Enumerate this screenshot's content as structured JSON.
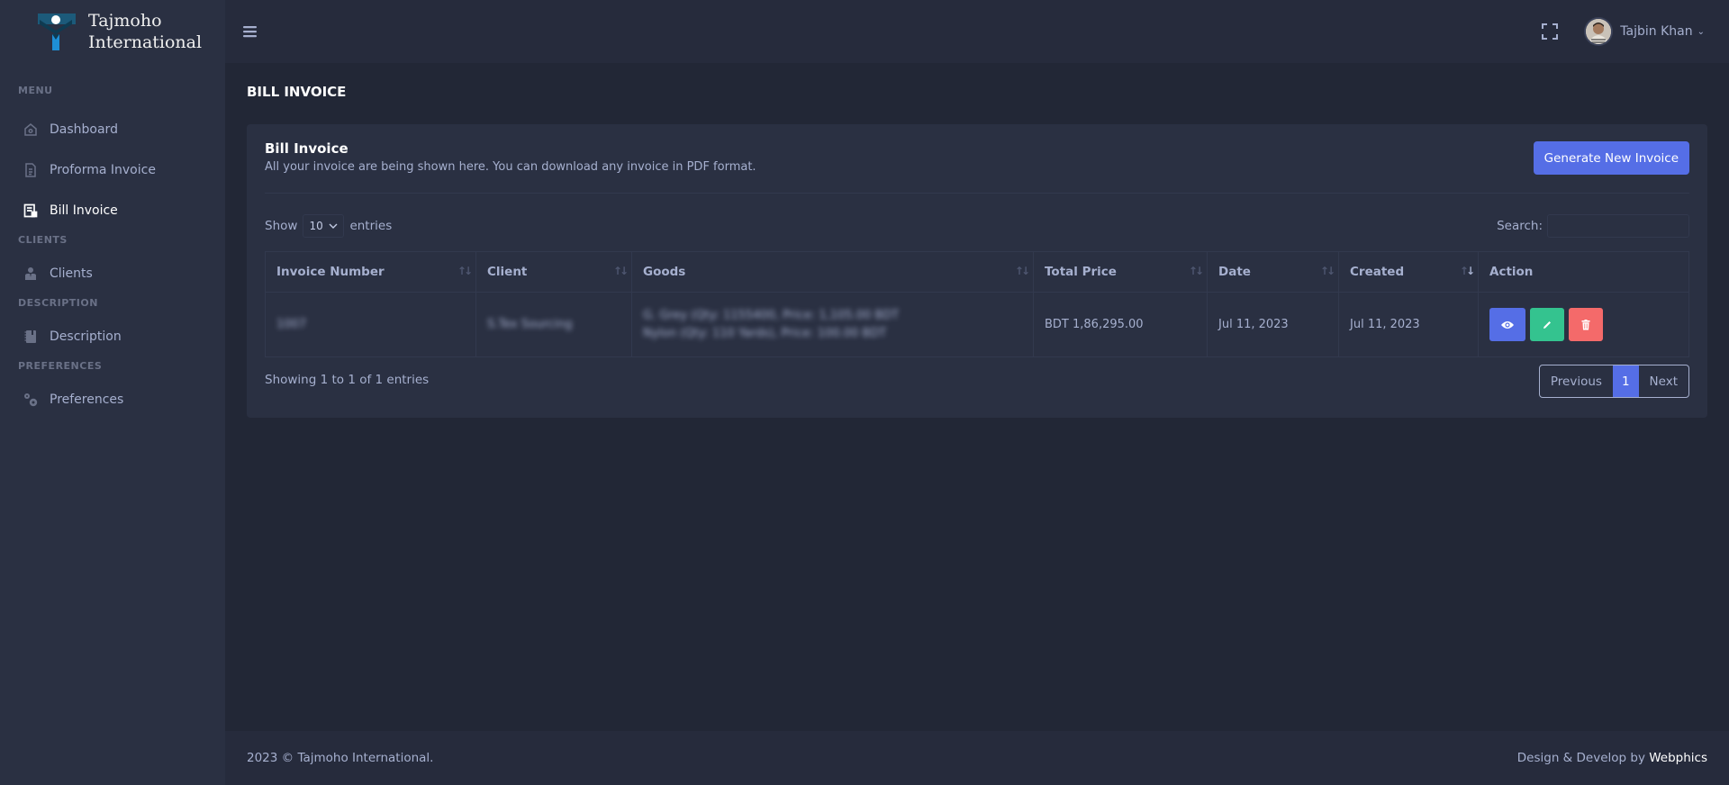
{
  "brand": {
    "line1": "Tajmoho",
    "line2": "International"
  },
  "sidebar": {
    "sections": [
      {
        "title": "Menu",
        "items": [
          {
            "label": "Dashboard",
            "icon": "home-icon",
            "active": false
          },
          {
            "label": "Proforma Invoice",
            "icon": "file-icon",
            "active": false
          },
          {
            "label": "Bill Invoice",
            "icon": "receipt-icon",
            "active": true
          }
        ]
      },
      {
        "title": "Clients",
        "items": [
          {
            "label": "Clients",
            "icon": "user-tie-icon",
            "active": false
          }
        ]
      },
      {
        "title": "Description",
        "items": [
          {
            "label": "Description",
            "icon": "notebook-icon",
            "active": false
          }
        ]
      },
      {
        "title": "Preferences",
        "items": [
          {
            "label": "Preferences",
            "icon": "gears-icon",
            "active": false
          }
        ]
      }
    ]
  },
  "topbar": {
    "user_name": "Tajbin Khan"
  },
  "page": {
    "title": "BILL INVOICE"
  },
  "card": {
    "title": "Bill Invoice",
    "subtitle": "All your invoice are being shown here. You can download any invoice in PDF format.",
    "generate_label": "Generate New Invoice",
    "show_label": "Show",
    "entries_label": "entries",
    "page_size": "10",
    "search_label": "Search:",
    "search_value": "",
    "columns": [
      "Invoice Number",
      "Client",
      "Goods",
      "Total Price",
      "Date",
      "Created",
      "Action"
    ],
    "rows": [
      {
        "invoice_number": "1007",
        "client": "S.Tex Sourcing",
        "goods_line1": "G. Grey (Qty: 1155400, Price: 1,105.00 BDT",
        "goods_line2": "Nylon (Qty: 110 Yards), Price: 100.00 BDT",
        "total_price": "BDT 1,86,295.00",
        "date": "Jul 11, 2023",
        "created": "Jul 11, 2023"
      }
    ],
    "info": "Showing 1 to 1 of 1 entries",
    "pagination": {
      "previous": "Previous",
      "current": "1",
      "next": "Next"
    }
  },
  "footer": {
    "copyright": "2023 © Tajmoho International.",
    "credit_prefix": "Design & Develop by",
    "credit_brand": "Webphics"
  },
  "colors": {
    "primary": "#556ee6",
    "success": "#34c38f",
    "danger": "#f46a6a"
  }
}
